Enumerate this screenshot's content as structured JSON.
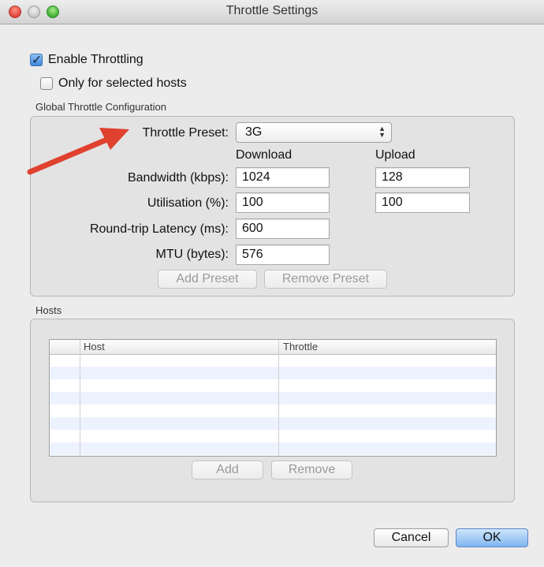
{
  "window": {
    "title": "Throttle Settings"
  },
  "options": {
    "enable_throttling": {
      "label": "Enable Throttling",
      "checked": true
    },
    "only_selected_hosts": {
      "label": "Only for selected hosts",
      "checked": false
    }
  },
  "global_config": {
    "group_title": "Global Throttle Configuration",
    "preset_label": "Throttle Preset:",
    "preset_value": "3G",
    "download_header": "Download",
    "upload_header": "Upload",
    "bandwidth_label": "Bandwidth (kbps):",
    "bandwidth_download": "1024",
    "bandwidth_upload": "128",
    "utilisation_label": "Utilisation (%):",
    "utilisation_download": "100",
    "utilisation_upload": "100",
    "latency_label": "Round-trip Latency (ms):",
    "latency_value": "600",
    "mtu_label": "MTU (bytes):",
    "mtu_value": "576",
    "add_preset_label": "Add Preset",
    "remove_preset_label": "Remove Preset"
  },
  "hosts": {
    "group_title": "Hosts",
    "columns": [
      "",
      "Host",
      "Throttle"
    ],
    "add_label": "Add",
    "remove_label": "Remove"
  },
  "footer": {
    "cancel_label": "Cancel",
    "ok_label": "OK"
  },
  "colors": {
    "annotation_arrow": "#e0412f",
    "checkbox_accent": "#3e86dd",
    "default_button": "#7fb5ef"
  }
}
